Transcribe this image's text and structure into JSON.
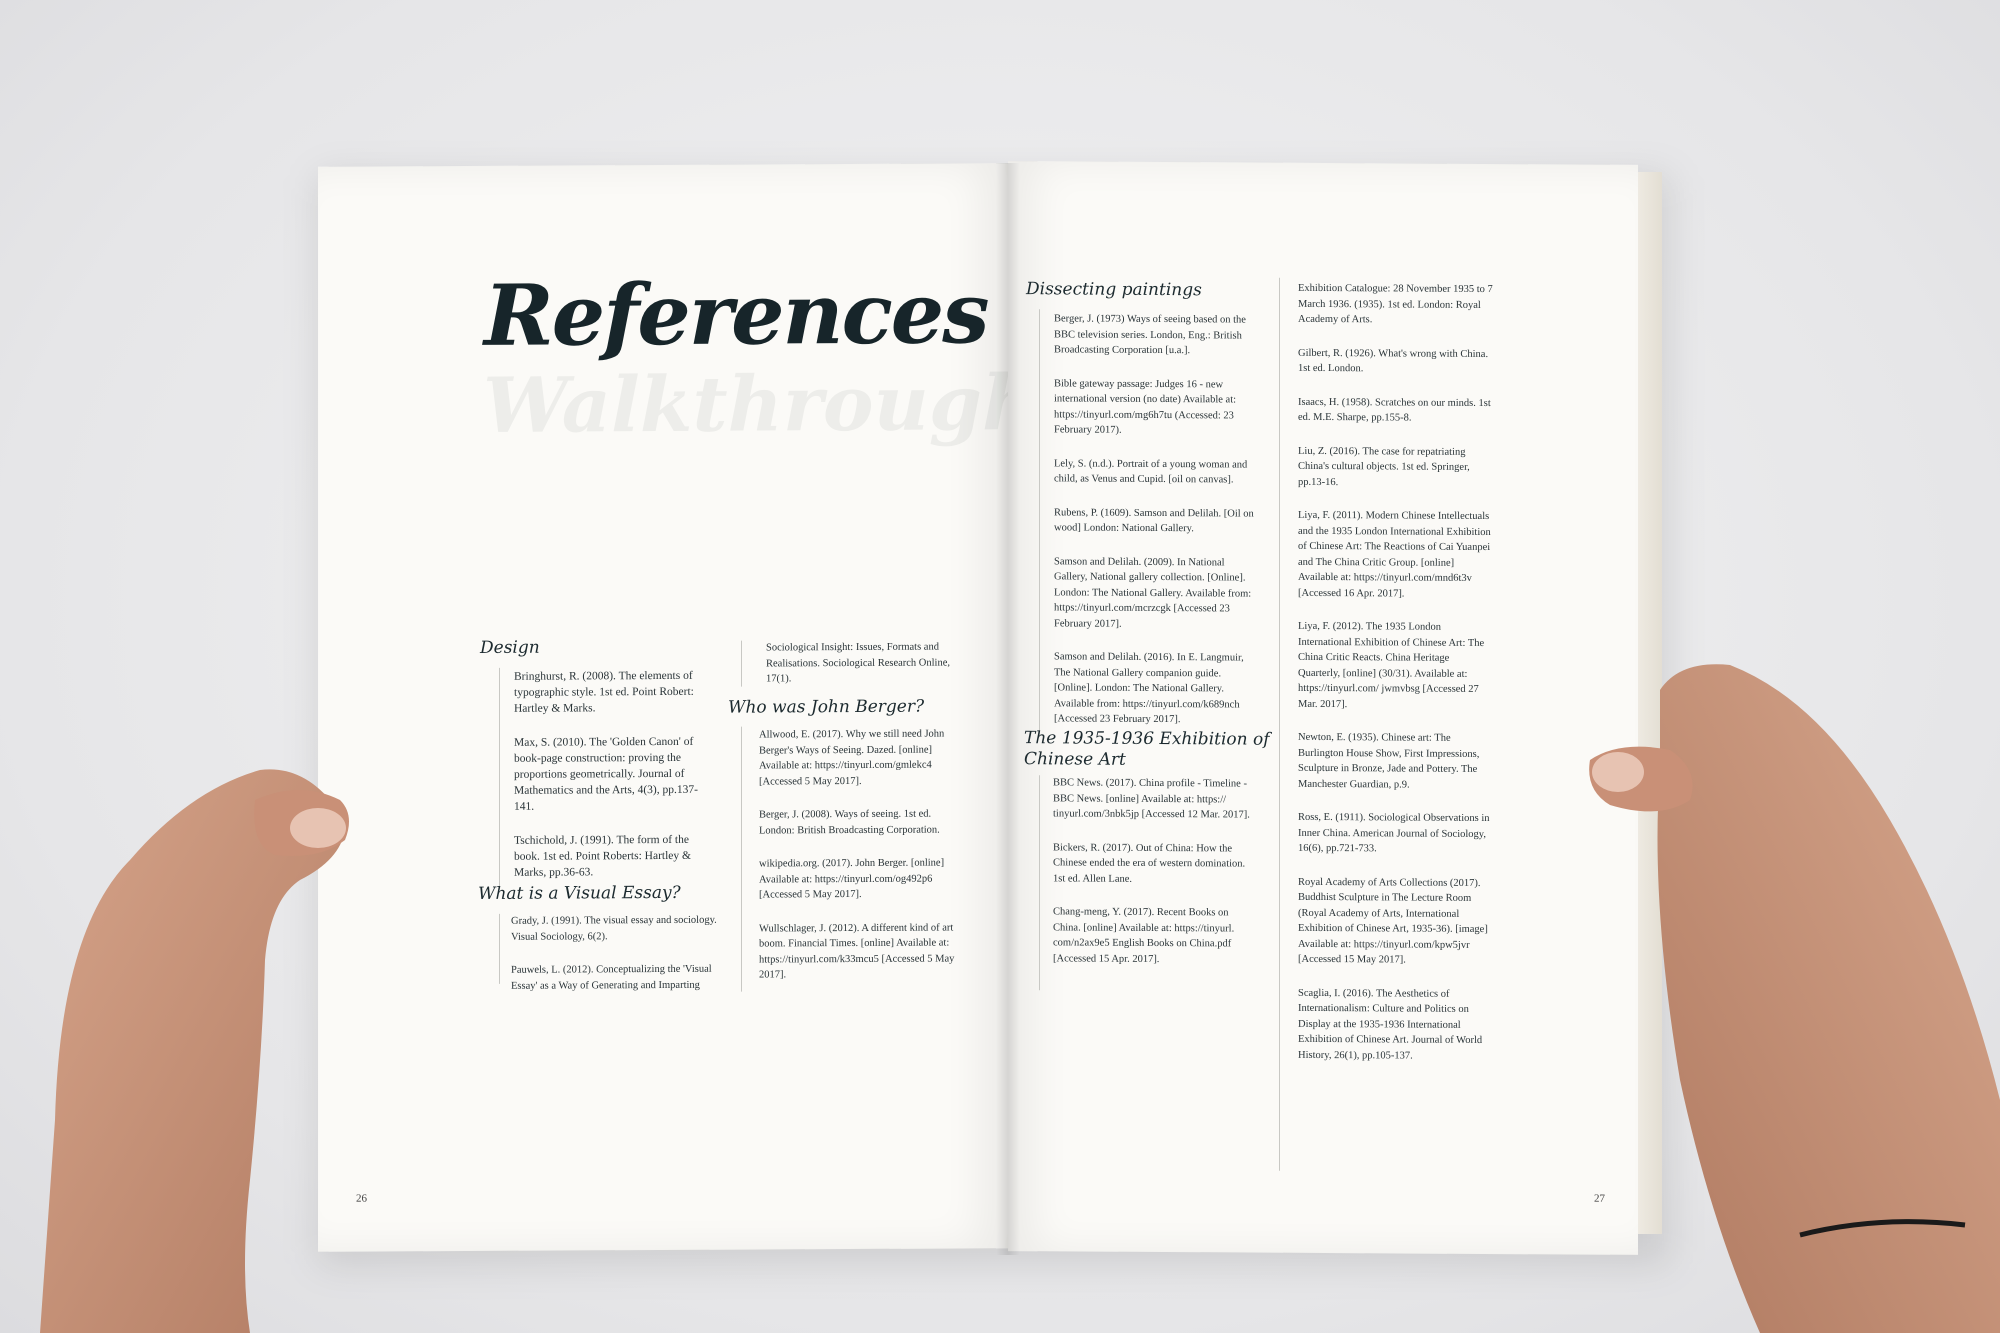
{
  "title": "References",
  "left": {
    "design_heading": "Design",
    "design_refs": [
      "Bringhurst, R. (2008). The elements of typographic style. 1st ed. Point Robert: Hartley & Marks.",
      "Max, S. (2010). The 'Golden Canon' of book-page construction: proving the proportions geometrically. Journal of Mathematics and the Arts, 4(3), pp.137-141.",
      "Tschichold, J. (1991). The form of the book. 1st ed. Point Roberts: Hartley & Marks, pp.36-63."
    ],
    "visual_essay_heading": "What is a Visual Essay?",
    "visual_essay_refs": [
      "Grady, J. (1991). The visual essay and sociology. Visual Sociology, 6(2).",
      "Pauwels, L. (2012). Conceptualizing the 'Visual Essay' as a Way of Generating and Imparting"
    ],
    "continued_ref": "Sociological Insight: Issues, Formats and Realisations. Sociological Research Online, 17(1).",
    "berger_heading": "Who was John Berger?",
    "berger_refs": [
      "Allwood, E. (2017). Why we still need John Berger's Ways of Seeing. Dazed. [online] Available at: https://tinyurl.com/gmlekc4 [Accessed 5 May 2017].",
      "Berger, J. (2008). Ways of seeing. 1st ed. London: British Broadcasting Corporation.",
      "wikipedia.org. (2017). John Berger. [online] Available at: https://tinyurl.com/og492p6 [Accessed 5 May 2017].",
      "Wullschlager, J. (2012). A different kind of art boom. Financial Times. [online] Available at: https://tinyurl.com/k33mcu5 [Accessed 5 May 2017]."
    ],
    "page_number": "26"
  },
  "right": {
    "paintings_heading": "Dissecting paintings",
    "paintings_refs": [
      "Berger, J. (1973) Ways of seeing based on the BBC television series. London, Eng.: British Broadcasting Corporation [u.a.].",
      "Bible gateway passage: Judges 16 - new international version (no date) Available at: https://tinyurl.com/mg6h7tu (Accessed: 23 February 2017).",
      "Lely, S. (n.d.). Portrait of a young woman and child, as Venus and Cupid. [oil on canvas].",
      "Rubens, P. (1609). Samson and Delilah. [Oil on wood] London: National Gallery.",
      "Samson and Delilah. (2009). In National Gallery, National gallery collection. [Online]. London: The National Gallery. Available from: https://tinyurl.com/mcrzcgk [Accessed 23 February 2017].",
      "Samson and Delilah. (2016). In E. Langmuir, The National Gallery companion guide. [Online]. London: The National Gallery. Available from: https://tinyurl.com/k689nch [Accessed 23 February 2017]."
    ],
    "exhibition_heading_line1": "The 1935-1936 Exhibition of",
    "exhibition_heading_line2": "Chinese Art",
    "exhibition_refs": [
      "BBC News. (2017). China profile - Timeline - BBC News. [online] Available at: https:// tinyurl.com/3nbk5jp [Accessed 12 Mar. 2017].",
      "Bickers, R. (2017). Out of China: How the Chinese ended the era of western domination. 1st ed. Allen Lane.",
      "Chang-meng, Y. (2017). Recent Books on China. [online] Available at: https://tinyurl. com/n2ax9e5 English Books on China.pdf [Accessed 15 Apr. 2017]."
    ],
    "column2_refs": [
      "Exhibition Catalogue: 28 November 1935 to 7 March 1936. (1935). 1st ed. London: Royal Academy of Arts.",
      "Gilbert, R. (1926). What's wrong with China. 1st ed. London.",
      "Isaacs, H. (1958). Scratches on our minds. 1st ed. M.E. Sharpe, pp.155-8.",
      "Liu, Z. (2016). The case for repatriating China's cultural objects. 1st ed. Springer, pp.13-16.",
      "Liya, F. (2011). Modern Chinese Intellectuals and the 1935 London International Exhibition of Chinese Art: The Reactions of Cai Yuanpei and The China Critic Group. [online] Available at: https://tinyurl.com/mnd6t3v [Accessed 16 Apr. 2017].",
      "Liya, F. (2012). The 1935 London International Exhibition of Chinese Art: The China Critic Reacts. China Heritage Quarterly, [online] (30/31). Available at: https://tinyurl.com/ jwmvbsg [Accessed 27 Mar. 2017].",
      "Newton, E. (1935). Chinese art: The Burlington House Show, First Impressions, Sculpture in Bronze, Jade and Pottery. The Manchester Guardian, p.9.",
      "Ross, E. (1911). Sociological Observations in Inner China. American Journal of Sociology, 16(6), pp.721-733.",
      "Royal Academy of Arts Collections (2017). Buddhist Sculpture in The Lecture Room (Royal Academy of Arts, International Exhibition of Chinese Art, 1935-36). [image] Available at: https://tinyurl.com/kpw5jvr [Accessed 15 May 2017].",
      "Scaglia, I. (2016). The Aesthetics of Internationalism: Culture and Politics on Display at the 1935-1936 International Exhibition of Chinese Art. Journal of World History, 26(1), pp.105-137."
    ],
    "page_number": "27"
  },
  "colors": {
    "background": "#e8e8ea",
    "paper": "#fbfaf7",
    "ink": "#17252a",
    "skin": "#c9957a"
  }
}
